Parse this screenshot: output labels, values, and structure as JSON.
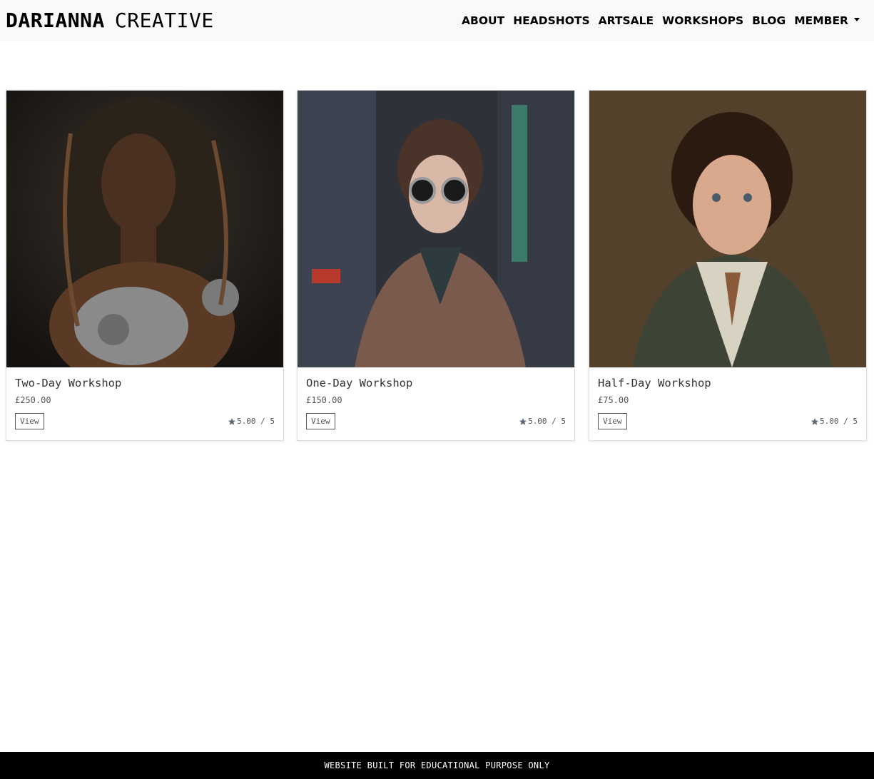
{
  "brand": {
    "part1": "DARIANNA",
    "part2": "CREATIVE"
  },
  "nav": [
    "ABOUT",
    "HEADSHOTS",
    "ARTSALE",
    "WORKSHOPS",
    "BLOG",
    "MEMBER"
  ],
  "cards": [
    {
      "title": "Two-Day Workshop",
      "price": "£250.00",
      "button": "View",
      "rating": "5.00 / 5"
    },
    {
      "title": "One-Day Workshop",
      "price": "£150.00",
      "button": "View",
      "rating": "5.00 / 5"
    },
    {
      "title": "Half-Day Workshop",
      "price": "£75.00",
      "button": "View",
      "rating": "5.00 / 5"
    }
  ],
  "footer": "WEBSITE BUILT FOR EDUCATIONAL PURPOSE ONLY",
  "colors": {
    "navbar_bg": "#f8f9fa",
    "footer_bg": "#000000",
    "star": "#5f6b77"
  }
}
